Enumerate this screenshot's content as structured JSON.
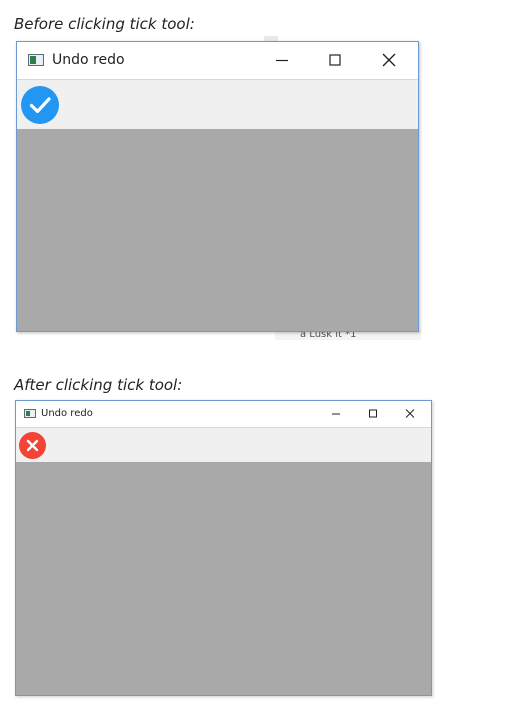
{
  "captions": {
    "before": "Before clicking tick tool:",
    "after": "After clicking tick tool:"
  },
  "before_window": {
    "title": "Undo redo",
    "icons": {
      "app": "app-window-icon",
      "minimize": "minimize-icon",
      "maximize": "maximize-icon",
      "close": "close-icon",
      "tool": "checkmark-circle-icon"
    },
    "colors": {
      "tool": "#2196f3",
      "toolbar": "#f0f0f0",
      "content": "#a9a9a9",
      "border": "#6b9bd2"
    }
  },
  "after_window": {
    "title": "Undo redo",
    "icons": {
      "app": "app-window-icon",
      "minimize": "minimize-icon",
      "maximize": "maximize-icon",
      "close": "close-icon",
      "tool": "x-circle-icon"
    },
    "colors": {
      "tool": "#f44336",
      "toolbar": "#f0f0f0",
      "content": "#a9a9a9",
      "border": "#6b9bd2"
    }
  },
  "background_fragments": {
    "text_before": "a Lusk it *1"
  }
}
